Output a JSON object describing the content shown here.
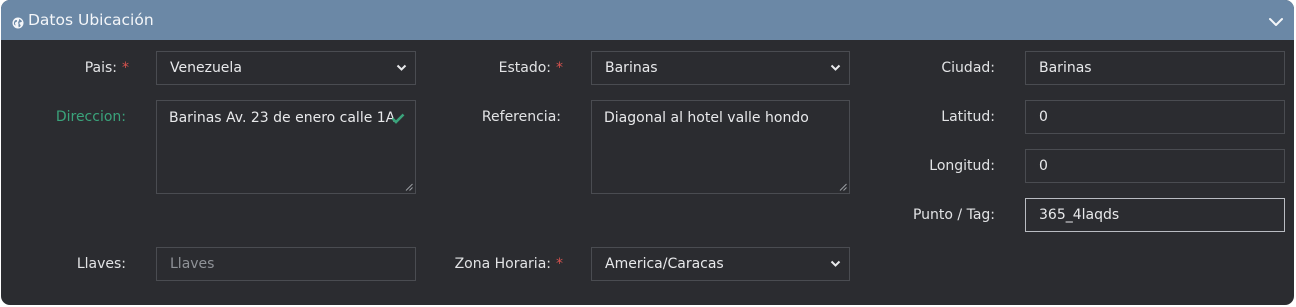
{
  "header": {
    "title": "Datos Ubicación",
    "icon": "globe-icon",
    "collapse_icon": "chevron-down-icon",
    "bg_color": "#6b88a6"
  },
  "form": {
    "pais": {
      "label": "Pais:",
      "required": "*",
      "value": "Venezuela"
    },
    "estado": {
      "label": "Estado:",
      "required": "*",
      "value": "Barinas"
    },
    "ciudad": {
      "label": "Ciudad:",
      "value": "Barinas"
    },
    "direccion": {
      "label": "Direccion:",
      "value": "Barinas Av. 23 de enero calle 1A",
      "valid_icon": "checkmark-icon",
      "label_color": "#3aa37b"
    },
    "referencia": {
      "label": "Referencia:",
      "value": "Diagonal al hotel valle hondo"
    },
    "latitud": {
      "label": "Latitud:",
      "value": "0"
    },
    "longitud": {
      "label": "Longitud:",
      "value": "0"
    },
    "punto_tag": {
      "label": "Punto / Tag:",
      "value": "365_4laqds"
    },
    "llaves": {
      "label": "Llaves:",
      "placeholder": "Llaves"
    },
    "zona_horaria": {
      "label": "Zona Horaria:",
      "required": "*",
      "value": "America/Caracas"
    }
  },
  "colors": {
    "panel_bg": "#2b2c30",
    "required": "#d9534f",
    "valid": "#3aa37b"
  }
}
